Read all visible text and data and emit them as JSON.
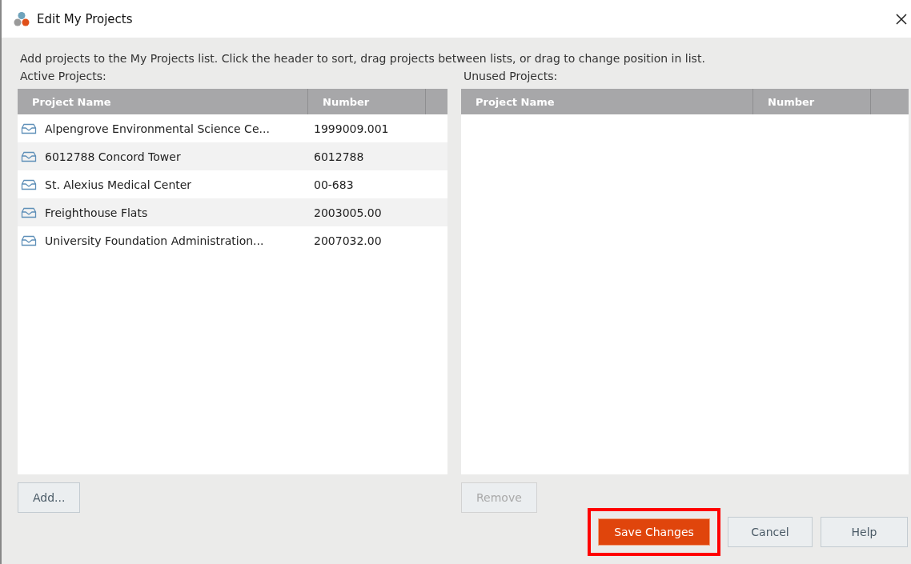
{
  "window": {
    "title": "Edit My Projects"
  },
  "instructions": "Add projects to the My Projects list. Click the header to sort, drag projects between lists, or drag to change position in list.",
  "active_projects": {
    "label": "Active Projects:",
    "columns": [
      "Project Name",
      "Number"
    ],
    "rows": [
      {
        "name": "Alpengrove Environmental Science Ce...",
        "number": "1999009.001"
      },
      {
        "name": "6012788 Concord Tower",
        "number": "6012788"
      },
      {
        "name": "St. Alexius Medical Center",
        "number": "00-683"
      },
      {
        "name": "Freighthouse Flats",
        "number": "2003005.00"
      },
      {
        "name": "University Foundation Administration...",
        "number": "2007032.00"
      }
    ],
    "button": {
      "label": "Add...",
      "disabled": false
    }
  },
  "unused_projects": {
    "label": "Unused Projects:",
    "columns": [
      "Project Name",
      "Number"
    ],
    "button": {
      "label": "Remove",
      "disabled": true
    }
  },
  "buttons": [
    {
      "label": "Save Changes",
      "kind": "primary",
      "highlighted": true
    },
    {
      "label": "Cancel",
      "kind": "normal",
      "highlighted": false
    },
    {
      "label": "Help",
      "kind": "normal",
      "highlighted": false
    }
  ]
}
